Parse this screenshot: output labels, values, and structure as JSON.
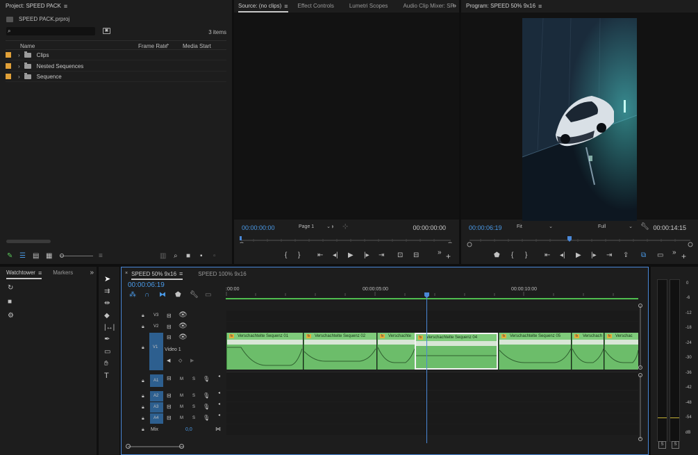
{
  "project": {
    "title": "Project: SPEED PACK",
    "file": "SPEED PACK.prproj",
    "item_count": "3 items",
    "search_placeholder": "",
    "columns": {
      "name": "Name",
      "frame_rate": "Frame Rate",
      "media_start": "Media Start"
    },
    "items": [
      {
        "name": "Clips"
      },
      {
        "name": "Nested Sequences"
      },
      {
        "name": "Sequence"
      }
    ]
  },
  "source": {
    "tabs": [
      "Source: (no clips)",
      "Effect Controls",
      "Lumetri Scopes",
      "Audio Clip Mixer: SP"
    ],
    "timecode_in": "00:00:00:00",
    "page_select": "Page 1",
    "timecode_out": "00:00:00:00"
  },
  "program": {
    "title": "Program: SPEED 50% 9x16",
    "timecode": "00:00:06:19",
    "fit_select": "Fit",
    "quality_select": "Full",
    "duration": "00:00:14:15"
  },
  "left_bottom": {
    "tabs": [
      "Watchtower",
      "Markers"
    ]
  },
  "timeline": {
    "tabs": [
      "SPEED 50% 9x16",
      "SPEED 100% 9x16"
    ],
    "timecode": "00:00:06:19",
    "ruler": [
      ":00:00",
      "00:00:05:00",
      "00:00:10:00"
    ],
    "video_tracks": [
      "V3",
      "V2",
      "V1"
    ],
    "v1_name": "Video 1",
    "audio_tracks": [
      "A1",
      "A2",
      "A3",
      "A4"
    ],
    "mix_label": "Mix",
    "mix_value": "0,0",
    "m_label": "M",
    "s_label": "S",
    "clips": [
      {
        "name": "Verschachtelte Sequenz 01"
      },
      {
        "name": "Verschachtelte Sequenz 02"
      },
      {
        "name": "Verschachte"
      },
      {
        "name": "Verschachtelte Sequenz 04"
      },
      {
        "name": "Verschachtelte Sequenz 05"
      },
      {
        "name": "Verschach"
      },
      {
        "name": "Verschac"
      }
    ]
  },
  "meter": {
    "scale": [
      "0",
      "-6",
      "-12",
      "-18",
      "-24",
      "-30",
      "-36",
      "-42",
      "-48",
      "-54",
      "dB"
    ],
    "solo": [
      "S",
      "S"
    ]
  },
  "colors": {
    "accent": "#4a9ae8",
    "label_orange": "#e0a038",
    "clip_green": "#6cbd6a",
    "playhead": "#4a88d8",
    "track_target": "#2d5f8f"
  }
}
